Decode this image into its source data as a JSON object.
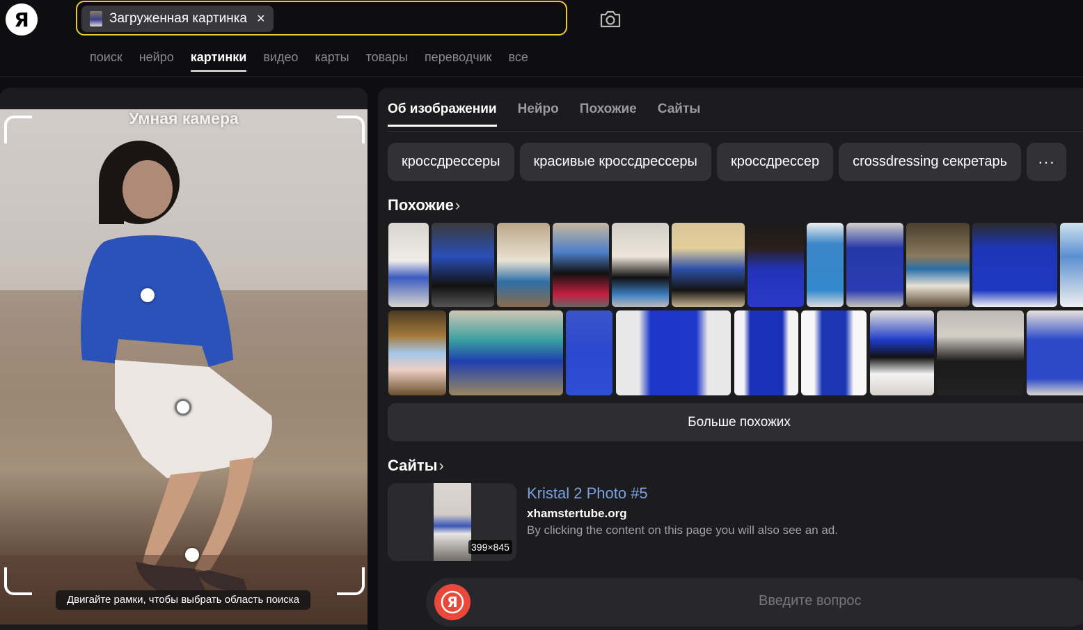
{
  "header": {
    "logo": "Я",
    "search_chip": "Загруженная картинка",
    "chip_close": "×",
    "tabs": [
      {
        "label": "поиск"
      },
      {
        "label": "нейро"
      },
      {
        "label": "картинки"
      },
      {
        "label": "видео"
      },
      {
        "label": "карты"
      },
      {
        "label": "товары"
      },
      {
        "label": "переводчик"
      },
      {
        "label": "все"
      }
    ],
    "active_tab": "картинки"
  },
  "smart_camera": {
    "title": "Умная камера",
    "hint": "Двигайте рамки, чтобы выбрать область поиска"
  },
  "panel": {
    "tabs": [
      {
        "label": "Об изображении"
      },
      {
        "label": "Нейро"
      },
      {
        "label": "Похожие"
      },
      {
        "label": "Сайты"
      }
    ],
    "tags": [
      {
        "label": "кроссдрессеры"
      },
      {
        "label": "красивые кроссдрессеры"
      },
      {
        "label": "кроссдрессер"
      },
      {
        "label": "crossdressing секретарь"
      }
    ],
    "tags_more": "···",
    "similar_title": "Похожие",
    "more_similar": "Больше похожих",
    "sites_title": "Сайты",
    "site": {
      "title": "Kristal 2 Photo #5",
      "domain": "xhamstertube.org",
      "description": "By clicking the content on this page you will also see an ad.",
      "size": "399×845"
    },
    "ask_placeholder": "Введите вопрос",
    "chevron": "›"
  },
  "colors": {
    "accent": "#f0c83a",
    "link": "#7aa2e0",
    "alice": "#e8493a",
    "background": "#0e0e10",
    "panel": "#1c1c1f"
  }
}
